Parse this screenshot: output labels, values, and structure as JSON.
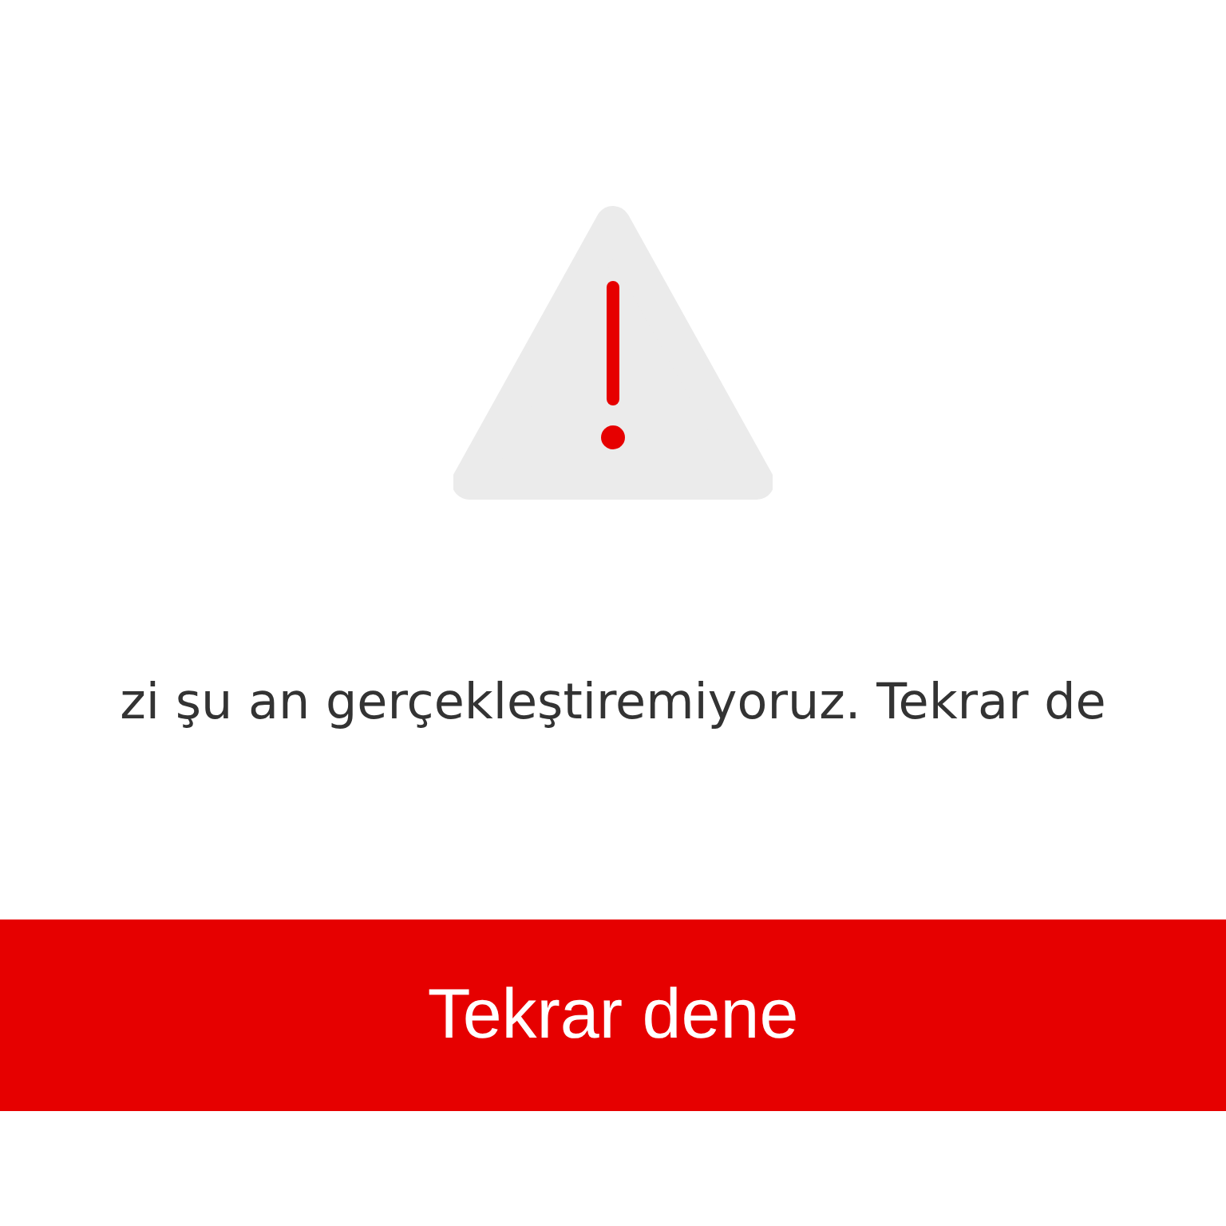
{
  "message": "zi şu an gerçekleştiremiyoruz. Tekrar de",
  "retry_button": {
    "label": "Tekrar dene"
  }
}
